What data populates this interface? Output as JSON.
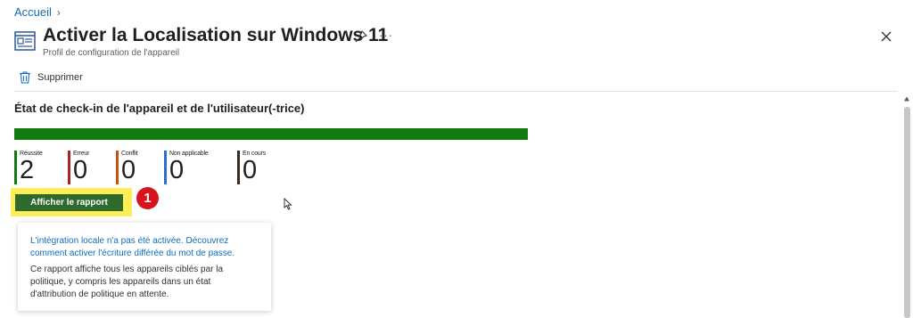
{
  "breadcrumb": {
    "home": "Accueil"
  },
  "header": {
    "title": "Activer la Localisation sur Windows 11",
    "subtitle": "Profil de configuration de l'appareil"
  },
  "toolbar": {
    "delete_label": "Supprimer"
  },
  "section": {
    "title": "État de check-in de l'appareil et de l'utilisateur(-trice)"
  },
  "progress": {
    "success_fraction": 1.0,
    "color": "#107c10"
  },
  "stats": [
    {
      "label": "Réussite",
      "value": "2",
      "color": "#107c10"
    },
    {
      "label": "Erreur",
      "value": "0",
      "color": "#a4262c"
    },
    {
      "label": "Conflit",
      "value": "0",
      "color": "#ca5010"
    },
    {
      "label": "Non applicable",
      "value": "0",
      "color": "#2b6cd4"
    },
    {
      "label": "En cours",
      "value": "0",
      "color": "#3b2a1a"
    }
  ],
  "report_button": {
    "label": "Afficher le rapport"
  },
  "annotation": {
    "step": "1"
  },
  "callout": {
    "link_text": "L'intégration locale n'a pas été activée. Découvrez comment activer l'écriture différée du mot de passe.",
    "body_text": "Ce rapport affiche tous les appareils ciblés par la politique, y compris les appareils dans un état d'attribution de politique en attente."
  }
}
